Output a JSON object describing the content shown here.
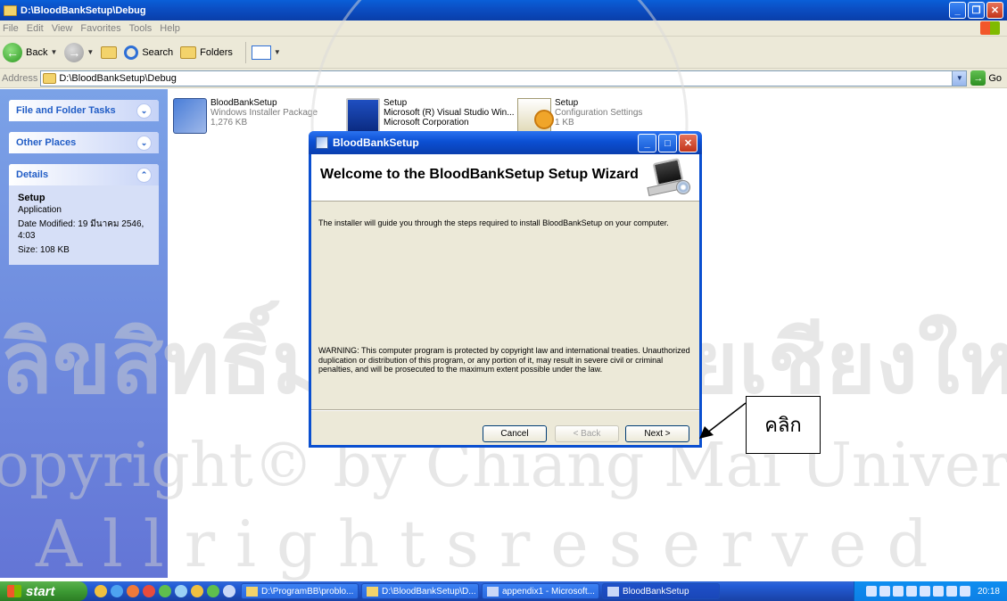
{
  "explorer": {
    "title": "D:\\BloodBankSetup\\Debug",
    "menu": [
      "File",
      "Edit",
      "View",
      "Favorites",
      "Tools",
      "Help"
    ],
    "toolbar": {
      "back": "Back",
      "search": "Search",
      "folders": "Folders"
    },
    "address": {
      "label": "Address",
      "value": "D:\\BloodBankSetup\\Debug",
      "go": "Go"
    }
  },
  "taskpane": {
    "file_tasks": "File and Folder Tasks",
    "other_places": "Other Places",
    "details": {
      "heading": "Details",
      "name": "Setup",
      "type": "Application",
      "modified": "Date Modified: 19 มีนาคม 2546, 4:03",
      "size": "Size: 108 KB"
    }
  },
  "files": [
    {
      "name": "BloodBankSetup",
      "line2": "Windows Installer Package",
      "line3": "1,276 KB",
      "icon": "installer-package-icon"
    },
    {
      "name": "Setup",
      "line2": "Microsoft (R) Visual Studio Win...",
      "line3": "Microsoft Corporation",
      "icon": "setup-application-icon"
    },
    {
      "name": "Setup",
      "line2": "Configuration Settings",
      "line3": "1 KB",
      "icon": "configuration-settings-icon"
    }
  ],
  "dialog": {
    "title": "BloodBankSetup",
    "heading": "Welcome to the BloodBankSetup Setup Wizard",
    "intro": "The installer will guide you through the steps required to install BloodBankSetup on your computer.",
    "warning": "WARNING: This computer program is protected by copyright law and international treaties. Unauthorized duplication or distribution of this program, or any portion of it, may result in severe civil or criminal penalties, and will be prosecuted to the maximum extent possible under the law.",
    "buttons": {
      "cancel": "Cancel",
      "back": "< Back",
      "next": "Next >"
    }
  },
  "callout": {
    "text": "คลิก"
  },
  "taskbar": {
    "start": "start",
    "tasks": [
      "D:\\ProgramBB\\problo...",
      "D:\\BloodBankSetup\\D...",
      "appendix1 - Microsoft...",
      "BloodBankSetup"
    ],
    "clock": "20:18"
  },
  "watermark": {
    "line1": "ลิขสิทธิ์มหาวิทยาลัยเชียงใหม่",
    "line2": "Copyright© by Chiang Mai University",
    "line3": "A l l   r i g h t s   r e s e r v e d"
  },
  "colors": {
    "xp_blue": "#0a4fd0",
    "taskpane_blue": "#6b8de0",
    "start_green": "#3d9a34"
  }
}
